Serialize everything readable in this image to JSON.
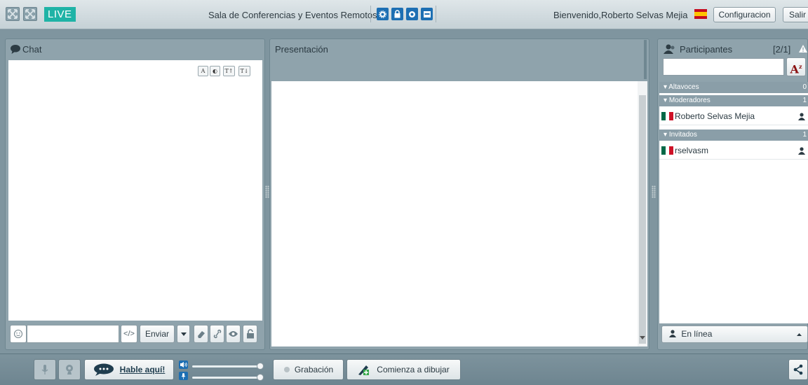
{
  "header": {
    "live_label": "LIVE",
    "room_title": "Sala de Conferencias y Eventos Remotos",
    "welcome": "Bienvenido,Roberto Selvas Mejia",
    "settings_label": "Configuracion",
    "exit_label": "Salir",
    "language_flag": "es-flag-icon"
  },
  "chat": {
    "title": "Chat",
    "tools": [
      "A",
      "◐",
      "T↑",
      "T↓"
    ],
    "input_placeholder": "",
    "code_label": "</>",
    "send_label": "Enviar"
  },
  "presentation": {
    "title": "Presentación"
  },
  "participants": {
    "title": "Participantes",
    "count": "[2/1]",
    "search_placeholder": "",
    "sort_label": "A",
    "groups": [
      {
        "label": "Altavoces",
        "count": "0",
        "users": []
      },
      {
        "label": "Moderadores",
        "count": "1",
        "users": [
          "Roberto Selvas Mejia"
        ]
      },
      {
        "label": "Invitados",
        "count": "1",
        "users": [
          "rselvasm"
        ]
      }
    ],
    "status_label": "En línea"
  },
  "bottom": {
    "talk_label": "Hable aquí!",
    "record_label": "Grabación",
    "draw_label": "Comienza a dibujar"
  },
  "colors": {
    "accent": "#1fb3a6",
    "toolbar_icon": "#1d6fb3",
    "panel": "#8fa3ac"
  }
}
